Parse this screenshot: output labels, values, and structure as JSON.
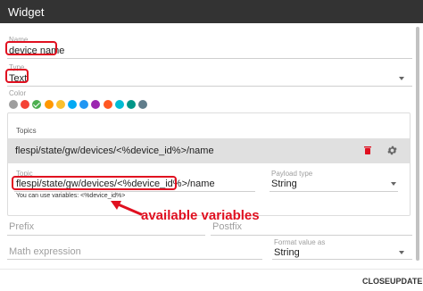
{
  "window": {
    "title": "Widget"
  },
  "name_field": {
    "label": "Name",
    "value": "device name"
  },
  "type_field": {
    "label": "Type",
    "value": "Text"
  },
  "color": {
    "label": "Color",
    "swatches": [
      "#9e9e9e",
      "#f44336",
      "#4caf50",
      "#ff9800",
      "#fbc02d",
      "#03a9f4",
      "#2196f3",
      "#9c27b0",
      "#ff5722",
      "#00bcd4",
      "#009688",
      "#607d8b"
    ],
    "selected_index": 2
  },
  "topics": {
    "header": "Topics",
    "row_text": "flespi/state/gw/devices/<%device_id%>/name",
    "topic_label": "Topic",
    "topic_value": "flespi/state/gw/devices/<%device_id%>/name",
    "payload_label": "Payload type",
    "payload_value": "String",
    "hint": "You can use variables: <%device_id%>"
  },
  "annotation": {
    "text": "available variables",
    "color": "#e01020"
  },
  "prefix_field": {
    "placeholder": "Prefix"
  },
  "postfix_field": {
    "placeholder": "Postfix"
  },
  "math_field": {
    "placeholder": "Math expression"
  },
  "format_field": {
    "label": "Format value as",
    "value": "String"
  },
  "footer": {
    "close_label": "CLOSE",
    "update_label": "UPDATE"
  }
}
